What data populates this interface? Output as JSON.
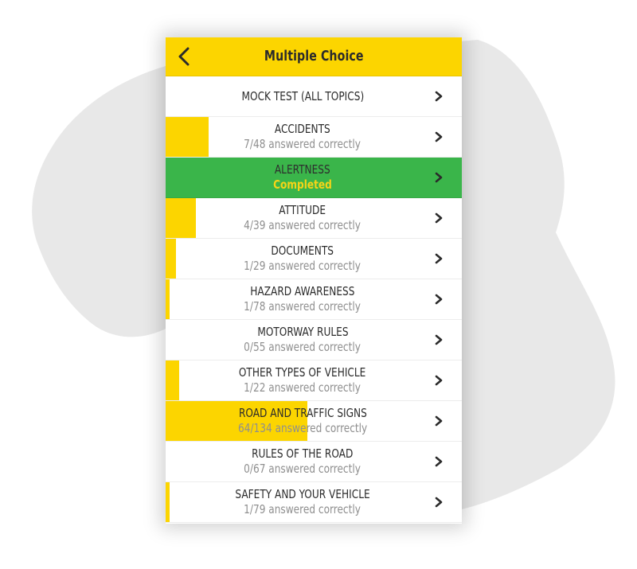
{
  "colors": {
    "accent_yellow": "#fcd500",
    "completed_green": "#3ab54a",
    "completed_text": "#f7d417",
    "title_text": "#2b2b2b",
    "sub_text": "#8f8f8f",
    "blob_gray": "#e8e8e8"
  },
  "header": {
    "title": "Multiple Choice",
    "back_icon": "chevron-left-icon"
  },
  "mock_test": {
    "title": "MOCK TEST (ALL TOPICS)",
    "icon": "chevron-right-icon"
  },
  "topics": [
    {
      "title": "ACCIDENTS",
      "correct": 7,
      "total": 48,
      "status": "7/48 answered correctly",
      "completed": false
    },
    {
      "title": "ALERTNESS",
      "correct": null,
      "total": null,
      "status": "Completed",
      "completed": true
    },
    {
      "title": "ATTITUDE",
      "correct": 4,
      "total": 39,
      "status": "4/39 answered correctly",
      "completed": false
    },
    {
      "title": "DOCUMENTS",
      "correct": 1,
      "total": 29,
      "status": "1/29 answered correctly",
      "completed": false
    },
    {
      "title": "HAZARD AWARENESS",
      "correct": 1,
      "total": 78,
      "status": "1/78 answered correctly",
      "completed": false
    },
    {
      "title": "MOTORWAY RULES",
      "correct": 0,
      "total": 55,
      "status": "0/55 answered correctly",
      "completed": false
    },
    {
      "title": "OTHER TYPES OF VEHICLE",
      "correct": 1,
      "total": 22,
      "status": "1/22 answered correctly",
      "completed": false
    },
    {
      "title": "ROAD AND TRAFFIC SIGNS",
      "correct": 64,
      "total": 134,
      "status": "64/134 answered correctly",
      "completed": false
    },
    {
      "title": "RULES OF THE ROAD",
      "correct": 0,
      "total": 67,
      "status": "0/67 answered correctly",
      "completed": false
    },
    {
      "title": "SAFETY AND YOUR VEHICLE",
      "correct": 1,
      "total": 79,
      "status": "1/79 answered correctly",
      "completed": false
    }
  ]
}
